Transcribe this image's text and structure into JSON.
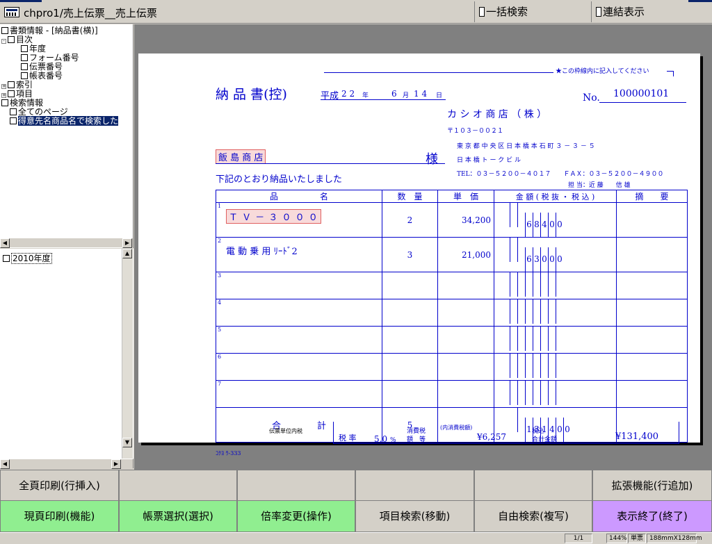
{
  "window": {
    "title": "chpro1/売上伝票__売上伝票",
    "batch_search": "一括検索",
    "linked_display": "連結表示"
  },
  "tree": {
    "items": [
      {
        "label": "書類情報 - [納品書(横)]"
      },
      {
        "label": "目次"
      },
      {
        "label": "年度"
      },
      {
        "label": "フォーム番号"
      },
      {
        "label": "伝票番号"
      },
      {
        "label": "帳表番号"
      },
      {
        "label": "索引"
      },
      {
        "label": "項目"
      },
      {
        "label": "検索情報"
      },
      {
        "label": "全てのページ"
      },
      {
        "label": "得意先名商品名で検索した"
      }
    ]
  },
  "year_pane": {
    "item": "2010年度"
  },
  "doc": {
    "note": "★この枠線内に記入してください",
    "title": "納 品 書(控)",
    "era": "平成",
    "year": "2 2",
    "year_unit": "年",
    "month": "6",
    "month_unit": "月",
    "day": "1 4",
    "day_unit": "日",
    "no_label": "No.",
    "no_value": "100000101",
    "company": "カ シ オ 商 店 （ 株 ）",
    "postal": "〒１０３－００２１",
    "address": "東 京 都 中 央 区 日 本 橋 本 石 町 ３ － ３ － ５",
    "building": "日 本 橋 ト ー ク ビ ル",
    "tel_fax": "TEL：０３－５２００－４０１７　　ＦＡＸ：０３－５２００－４９００",
    "staff": "担 当：近 藤　　信 雄",
    "customer": "飯 島 商 店",
    "honorific": "様",
    "message": "下記のとおり納品いたしました",
    "headers": {
      "item": "品　　　　　名",
      "qty": "数　量",
      "price": "単　価",
      "amount": "金 額 ( 税 抜 ・ 税 込 )",
      "remarks": "摘　　要"
    },
    "rows": [
      {
        "no": "1",
        "name": "Ｔ Ｖ － ３ ０ ０ ０",
        "qty": "2",
        "price": "34,200",
        "digits": [
          "",
          "",
          "6",
          "8",
          "4",
          "0",
          "0"
        ]
      },
      {
        "no": "2",
        "name": "電 動 乗 用 ﾘｰﾄﾞ2",
        "qty": "3",
        "price": "21,000",
        "digits": [
          "",
          "",
          "6",
          "3",
          "0",
          "0",
          "0"
        ]
      },
      {
        "no": "3",
        "name": "",
        "qty": "",
        "price": "",
        "digits": [
          "",
          "",
          "",
          "",
          "",
          "",
          ""
        ]
      },
      {
        "no": "4",
        "name": "",
        "qty": "",
        "price": "",
        "digits": [
          "",
          "",
          "",
          "",
          "",
          "",
          ""
        ]
      },
      {
        "no": "5",
        "name": "",
        "qty": "",
        "price": "",
        "digits": [
          "",
          "",
          "",
          "",
          "",
          "",
          ""
        ]
      },
      {
        "no": "6",
        "name": "",
        "qty": "",
        "price": "",
        "digits": [
          "",
          "",
          "",
          "",
          "",
          "",
          ""
        ]
      },
      {
        "no": "7",
        "name": "",
        "qty": "",
        "price": "",
        "digits": [
          "",
          "",
          "",
          "",
          "",
          "",
          ""
        ]
      }
    ],
    "total_label": "合　　　　計",
    "total_qty": "5",
    "total_digits": [
      "",
      "1",
      "3",
      "1",
      "4",
      "0",
      "0"
    ],
    "tax_unit_note": "伝票単位内税",
    "tax_rate_label": "税 率",
    "tax_rate": "5.0",
    "tax_rate_unit": "%",
    "tax_label_1": "消費税",
    "tax_label_2": "額　等",
    "inner_tax_label": "(内消費税額)",
    "inner_tax": "¥6,257",
    "total_in_1": "税込",
    "total_in_2": "合計金額",
    "grand_total": "¥131,400",
    "footer_code": "ｺｸﾖ ｳ-333"
  },
  "buttons": {
    "row1": [
      "全頁印刷(行挿入)",
      "",
      "",
      "",
      "",
      "拡張機能(行追加)"
    ],
    "row2": [
      "現頁印刷(機能)",
      "帳票選択(選択)",
      "倍率変更(操作)",
      "項目検索(移動)",
      "自由検索(複写)",
      "表示終了(終了)"
    ]
  },
  "status": {
    "page": "1/1",
    "zoom": "144%",
    "mode": "単票",
    "size": "188mmX128mm"
  }
}
